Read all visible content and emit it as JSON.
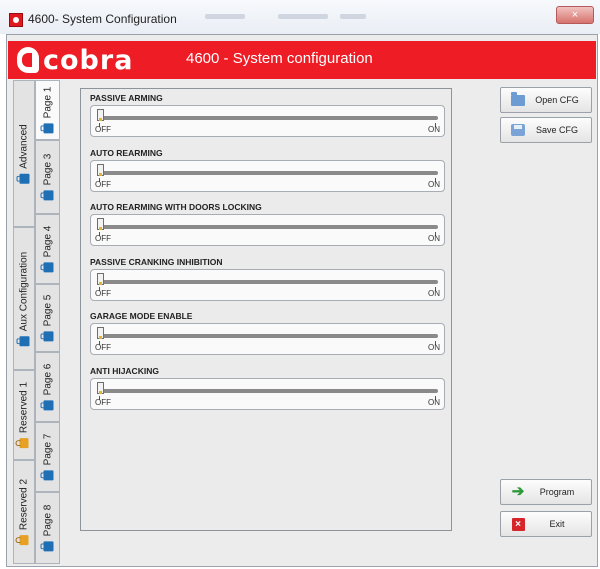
{
  "window": {
    "title": "4600- System Configuration",
    "close": "×"
  },
  "header": {
    "logo_text": "cobra",
    "title": "4600 - System configuration"
  },
  "tabs": [
    {
      "label": "Page 1",
      "icon": "bag-icon"
    },
    {
      "label": "Advanced",
      "icon": "bag-icon"
    },
    {
      "label": "Page 3",
      "icon": "bag-icon"
    },
    {
      "label": "Page 4",
      "icon": "bag-icon"
    },
    {
      "label": "Aux Configuration",
      "icon": "bag-icon"
    },
    {
      "label": "Page 5",
      "icon": "bag-icon"
    },
    {
      "label": "Page 6",
      "icon": "bag-icon"
    },
    {
      "label": "Reserved 1",
      "icon": "lock-icon"
    },
    {
      "label": "Page 7",
      "icon": "bag-icon"
    },
    {
      "label": "Reserved 2",
      "icon": "lock-icon"
    },
    {
      "label": "Page 8",
      "icon": "bag-icon"
    }
  ],
  "settings": [
    {
      "label": "PASSIVE ARMING",
      "off": "OFF",
      "on": "ON",
      "value": 0
    },
    {
      "label": "AUTO REARMING",
      "off": "OFF",
      "on": "ON",
      "value": 0
    },
    {
      "label": "AUTO REARMING WITH DOORS LOCKING",
      "off": "OFF",
      "on": "ON",
      "value": 0
    },
    {
      "label": "PASSIVE CRANKING INHIBITION",
      "off": "OFF",
      "on": "ON",
      "value": 0
    },
    {
      "label": "GARAGE MODE ENABLE",
      "off": "OFF",
      "on": "ON",
      "value": 0
    },
    {
      "label": "ANTI HIJACKING",
      "off": "OFF",
      "on": "ON",
      "value": 0
    }
  ],
  "buttons": {
    "open_cfg": "Open CFG",
    "save_cfg": "Save CFG",
    "program": "Program",
    "exit": "Exit"
  },
  "colors": {
    "brand_red": "#ee1c25",
    "accent_blue": "#1f6fb5",
    "lock_orange": "#e6a024"
  }
}
